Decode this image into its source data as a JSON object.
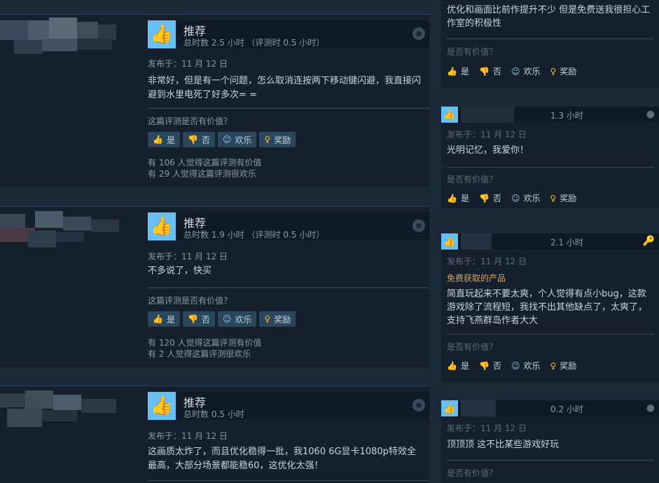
{
  "left_reviews": [
    {
      "vote": "推荐",
      "hours": "总时数 2.5 小时 （评测时 0.5 小时）",
      "posted": "发布于：11 月 12 日",
      "content": "非常好，但是有一个问题，怎么取消连按两下移动键闪避，我直接闪避到水里电死了好多次= =",
      "helpful_q": "这篇评测是否有价值？",
      "stats": [
        "有 106 人觉得这篇评测有价值",
        "有 29 人觉得这篇评测很欢乐"
      ]
    },
    {
      "vote": "推荐",
      "hours": "总时数 1.9 小时 （评测时 0.5 小时）",
      "posted": "发布于：11 月 12 日",
      "content": "不多说了，快买",
      "helpful_q": "这篇评测是否有价值？",
      "stats": [
        "有 120 人觉得这篇评测有价值",
        "有 2 人觉得这篇评测很欢乐"
      ]
    },
    {
      "vote": "推荐",
      "hours": "总时数 0.5 小时",
      "posted": "发布于：11 月 12 日",
      "content": "这画质太炸了，而且优化稳得一批，我1060 6G显卡1080p特效全最高，大部分场景都能稳60，这优化太强！"
    }
  ],
  "buttons": {
    "yes": "是",
    "no": "否",
    "funny": "欢乐",
    "award": "奖励"
  },
  "side_reviews": [
    {
      "content": "优化和画面比前作提升不少 但是免费送我很担心工作室的积极性",
      "helpful_q": "是否有价值？"
    },
    {
      "hours": "1.3 小时",
      "posted": "发布于：11 月 12 日",
      "content": "光明记忆，我爱你！",
      "helpful_q": "是否有价值？"
    },
    {
      "hours": "2.1 小时",
      "posted": "发布于：11 月 12 日",
      "product": "免费获取的产品",
      "content": "简直玩起来不要太爽，个人觉得有点小bug，这款游戏除了流程短，我找不出其他缺点了，太爽了，支持飞燕群岛作者大大",
      "helpful_q": "是否有价值？"
    },
    {
      "hours": "0.2 小时",
      "posted": "发布于：11 月 12 日",
      "content": "顶顶顶 这不比某些游戏好玩",
      "helpful_q": "是否有价值？"
    }
  ],
  "icons": {
    "thumb_up": "thumbs-up-icon",
    "thumb_down": "thumbs-down-icon",
    "funny": "smiley-icon",
    "award": "award-icon",
    "steam": "steam-icon",
    "key": "key-icon"
  }
}
